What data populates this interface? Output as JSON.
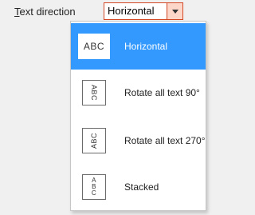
{
  "field": {
    "label_first": "T",
    "label_rest": "ext direction",
    "value": "Horizontal",
    "arrow_icon": "chevron-down-icon"
  },
  "menu": {
    "items": [
      {
        "label": "Horizontal",
        "preview": "ABC",
        "preview_letters": [
          "A",
          "B",
          "C"
        ],
        "selected": true
      },
      {
        "label": "Rotate all text 90°",
        "preview": "ABC",
        "selected": false
      },
      {
        "label": "Rotate all text 270°",
        "preview": "ABC",
        "selected": false
      },
      {
        "label": "Stacked",
        "preview_letters": [
          "A",
          "B",
          "C"
        ],
        "selected": false
      }
    ]
  },
  "colors": {
    "accent_border": "#d24726",
    "selection": "#3399ff"
  }
}
